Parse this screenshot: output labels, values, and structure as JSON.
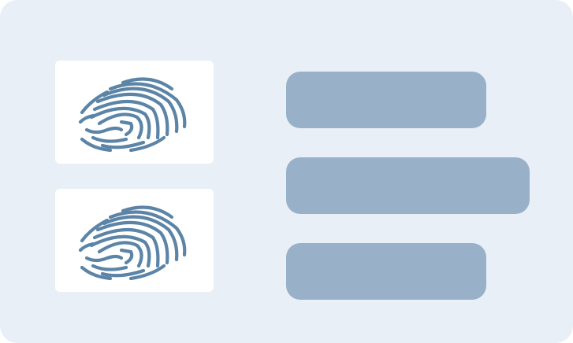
{
  "colors": {
    "background": "#e9eff7",
    "tile": "#ffffff",
    "fingerprint": "#5b84a7",
    "bar": "#98b1c9"
  },
  "icons": {
    "primary": "fingerprint-icon",
    "secondary": "fingerprint-icon"
  }
}
